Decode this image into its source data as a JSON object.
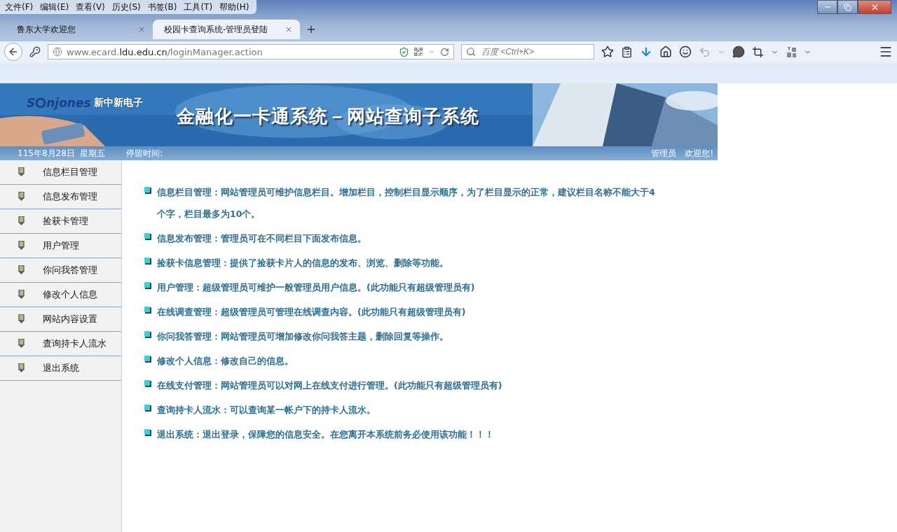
{
  "menu_bar": [
    "文件(F)",
    "编辑(E)",
    "查看(V)",
    "历史(S)",
    "书签(B)",
    "工具(T)",
    "帮助(H)"
  ],
  "tabs": [
    {
      "label": "鲁东大学欢迎您",
      "selected": false
    },
    {
      "label": "校园卡查询系统-管理员登陆",
      "selected": true
    }
  ],
  "address_bar": {
    "prefix": "www.ecard.",
    "domain": "ldu.edu.cn",
    "path": "/loginManager.action"
  },
  "search": {
    "placeholder": "百度 <Ctrl+K>"
  },
  "banner": {
    "logo_prefix": "S",
    "logo_suffix": "njones",
    "logo_tagline": "新中新电子",
    "title": "金融化一卡通系统－网站查询子系统"
  },
  "status": {
    "date": "115年8月28日  星期五",
    "stay_label": "停留时间:",
    "role": "管理员",
    "welcome": "欢迎您!"
  },
  "sidebar": {
    "items": [
      "信息栏目管理",
      "信息发布管理",
      "捡获卡管理",
      "用户管理",
      "你问我答管理",
      "修改个人信息",
      "网站内容设置",
      "查询持卡人流水",
      "退出系统"
    ]
  },
  "descriptions": [
    "信息栏目管理：网站管理员可维护信息栏目。增加栏目，控制栏目显示顺序，为了栏目显示的正常，建议栏目名称不能大于4个字，栏目最多为10个。",
    "信息发布管理：管理员可在不同栏目下面发布信息。",
    "捡获卡信息管理：提供了捡获卡片人的信息的发布、浏览、删除等功能。",
    "用户管理：超级管理员可维护一般管理员用户信息。(此功能只有超级管理员有)",
    "在线调查管理：超级管理员可管理在线调查内容。(此功能只有超级管理员有)",
    "你问我答管理：网站管理员可增加修改你问我答主题，删除回复等操作。",
    "修改个人信息：修改自己的信息。",
    "在线支付管理：网站管理员可以对网上在线支付进行管理。(此功能只有超级管理员有)",
    "查询持卡人流水：可以查询某一帐户下的持卡人流水。",
    "退出系统：退出登录，保障您的信息安全。在您离开本系统前务必使用该功能！！！"
  ]
}
